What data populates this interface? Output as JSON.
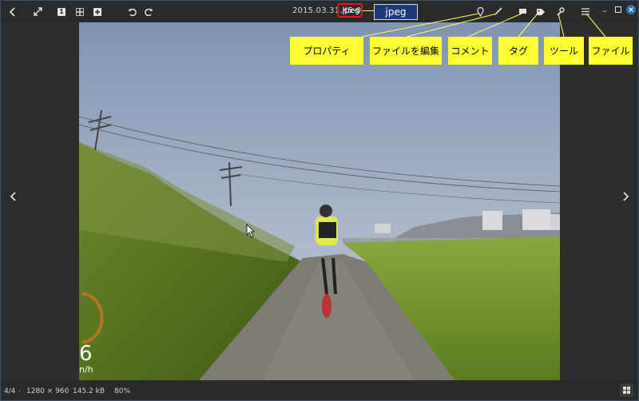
{
  "window": {
    "title": "2015.03.31 K5-0",
    "extension": ".jpeg",
    "callout_text": "jpeg"
  },
  "toolbar": {
    "left_icons": [
      "back-icon",
      "fullscreen-icon",
      "single-view-icon",
      "grid-view-icon",
      "add-icon",
      "rotate-left-icon",
      "rotate-right-icon"
    ],
    "single_label": "1"
  },
  "labels": {
    "properties": "プロパティ",
    "edit_file": "ファイルを編集",
    "comment": "コメント",
    "tag": "タグ",
    "tools": "ツール",
    "file": "ファイル"
  },
  "overlay": {
    "speed_digit": "6",
    "speed_unit": "n/h"
  },
  "status": {
    "index": "4/4",
    "separator": "·",
    "resolution": "1280 × 960",
    "size": "145.2 kB",
    "zoom": "80%"
  },
  "colors": {
    "callout_yellow": "#ffff33",
    "highlight_red": "#e01a1a",
    "callout_blue": "#1c3b78"
  }
}
